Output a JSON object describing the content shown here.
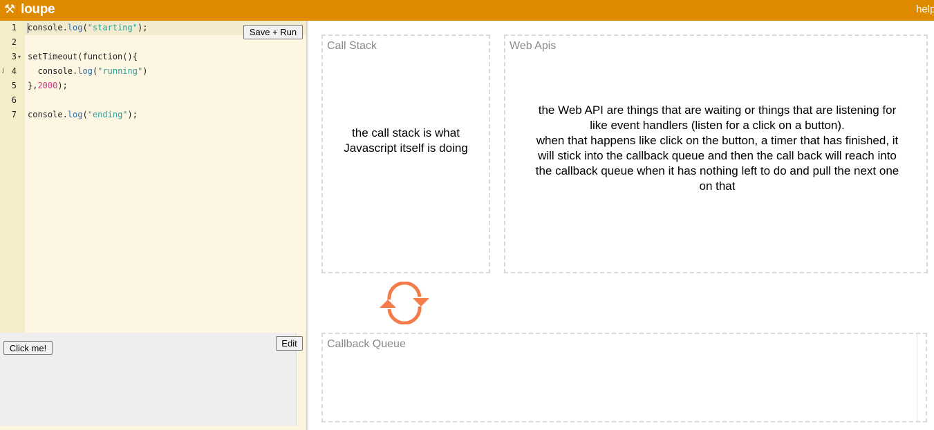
{
  "app": {
    "logo_icon": "hammer-and-wrench-icon",
    "logo_text": "loupe",
    "help_label": "help",
    "accent_color": "#e08a00"
  },
  "editor": {
    "line_numbers": [
      "1",
      "2",
      "3",
      "4",
      "5",
      "6",
      "7"
    ],
    "lines": [
      "console.log(\"starting\");",
      "",
      "setTimeout(function(){",
      "  console.log(\"running\")",
      "},2000);",
      "",
      "console.log(\"ending\");"
    ],
    "save_run_label": "Save + Run"
  },
  "html_preview": {
    "click_me_label": "Click me!",
    "edit_label": "Edit"
  },
  "call_stack": {
    "title": "Call Stack",
    "note": "the call stack is what Javascript itself is doing"
  },
  "web_apis": {
    "title": "Web Apis",
    "note": "the Web API are things that are waiting or things that are listening for like event handlers (listen for a click on a button).\nwhen that happens like click on the button, a timer that has finished, it will stick into the callback queue and then the call back will reach into the callback queue when it has nothing left to do and pull the next one on that"
  },
  "callback_queue": {
    "title": "Callback Queue"
  },
  "event_loop": {
    "icon": "event-loop-refresh-icon",
    "color": "#f47c4a"
  }
}
